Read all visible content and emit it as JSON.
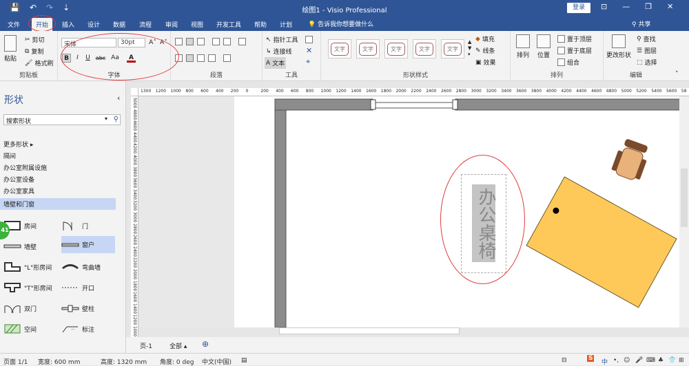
{
  "titlebar": {
    "title": "绘图1 - Visio Professional",
    "login": "登录",
    "qat": [
      "💾",
      "↶",
      "↷",
      "⇣"
    ],
    "winctl": [
      "⊡",
      "—",
      "❐",
      "✕"
    ]
  },
  "tabs": [
    {
      "label": "文件",
      "active": false
    },
    {
      "label": "开始",
      "active": true
    },
    {
      "label": "插入",
      "active": false
    },
    {
      "label": "设计",
      "active": false
    },
    {
      "label": "数据",
      "active": false
    },
    {
      "label": "流程",
      "active": false
    },
    {
      "label": "审阅",
      "active": false
    },
    {
      "label": "视图",
      "active": false
    },
    {
      "label": "开发工具",
      "active": false
    },
    {
      "label": "帮助",
      "active": false
    },
    {
      "label": "计划",
      "active": false
    }
  ],
  "tellme": "告诉我你想要做什么",
  "share": "共享",
  "ribbon": {
    "clipboard": {
      "label": "剪贴板",
      "paste": "粘贴",
      "cut": "剪切",
      "copy": "复制",
      "format_painter": "格式刷"
    },
    "font": {
      "label": "字体",
      "font_name": "宋体",
      "font_size": "30pt",
      "grow": "A˄",
      "shrink": "A˅",
      "bold": "B",
      "italic": "I",
      "underline": "U",
      "strike": "abc",
      "case": "Aa",
      "color": "A"
    },
    "paragraph": {
      "label": "段落"
    },
    "tools": {
      "label": "工具",
      "pointer": "指针工具",
      "connector": "连接线",
      "text": "文本"
    },
    "shape_styles": {
      "label": "形状样式",
      "sample": "文字",
      "fill": "填充",
      "line": "线条",
      "effects": "效果"
    },
    "arrange": {
      "label": "排列",
      "align": "排列",
      "position": "位置",
      "to_front": "置于顶层",
      "to_back": "置于底层",
      "group": "组合"
    },
    "editing": {
      "label": "编辑",
      "change_shape": "更改形状",
      "find": "查找",
      "layers": "图层",
      "select": "选择"
    }
  },
  "shapes_panel": {
    "title": "形状",
    "search_placeholder": "搜索形状",
    "more_shapes": "更多形状",
    "stencils": [
      "隔间",
      "办公室附属设施",
      "办公室设备",
      "办公室家具",
      "墙壁和门窗"
    ],
    "selected_stencil": "墙壁和门窗",
    "shapes": [
      {
        "label": "房间",
        "icon": "room-icon",
        "col": 0,
        "row": 0
      },
      {
        "label": "门",
        "icon": "door-icon",
        "col": 1,
        "row": 0
      },
      {
        "label": "墙壁",
        "icon": "wall-icon",
        "col": 0,
        "row": 1
      },
      {
        "label": "窗户",
        "icon": "window-icon",
        "col": 1,
        "row": 1,
        "selected": true
      },
      {
        "label": "\"L\"形房间",
        "icon": "l-room-icon",
        "col": 0,
        "row": 2
      },
      {
        "label": "弯曲墙",
        "icon": "curved-wall-icon",
        "col": 1,
        "row": 2
      },
      {
        "label": "\"T\"形房间",
        "icon": "t-room-icon",
        "col": 0,
        "row": 3
      },
      {
        "label": "开口",
        "icon": "opening-icon",
        "col": 1,
        "row": 3
      },
      {
        "label": "双门",
        "icon": "double-door-icon",
        "col": 0,
        "row": 4
      },
      {
        "label": "壁柱",
        "icon": "pilaster-icon",
        "col": 1,
        "row": 4
      },
      {
        "label": "空间",
        "icon": "space-icon",
        "col": 0,
        "row": 5
      },
      {
        "label": "标注",
        "icon": "dimension-icon",
        "col": 1,
        "row": 5
      }
    ],
    "badge": "41"
  },
  "ruler_h": [
    "1300",
    "1200",
    "1000",
    "800",
    "600",
    "400",
    "200",
    "0",
    "200",
    "400",
    "600",
    "800",
    "1000",
    "1200",
    "1400",
    "1600",
    "1800",
    "2000",
    "2200",
    "2400",
    "2600",
    "2800",
    "3000",
    "3200",
    "3400",
    "3600",
    "3800",
    "4000",
    "4200",
    "4400",
    "4600",
    "4800",
    "5000",
    "5200",
    "5400",
    "5600",
    "58"
  ],
  "ruler_v": [
    "5000",
    "4800",
    "4600",
    "4400",
    "4200",
    "4000",
    "3800",
    "3600",
    "3400",
    "3200",
    "3000",
    "2800",
    "2600",
    "2400",
    "2200",
    "2000",
    "1800",
    "1600",
    "1400",
    "1200",
    "1000"
  ],
  "canvas": {
    "text_box": "办公桌椅",
    "desk_color": "#ffc95a",
    "chair_color": "#e8b27a",
    "chair_frame": "#7a4a2a",
    "wall_color": "#8c8c8c"
  },
  "pagebar": {
    "page": "页-1",
    "all": "全部",
    "add": "⊕"
  },
  "status": {
    "page": "页面 1/1",
    "width": "宽度: 600 mm",
    "height": "高度: 1320 mm",
    "angle": "角度: 0 deg",
    "lang": "中文(中国)"
  },
  "accent_color": "#2f5597",
  "annotation_color": "#e23a3a"
}
